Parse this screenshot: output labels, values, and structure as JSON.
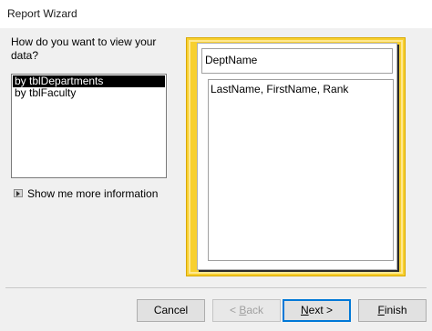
{
  "window": {
    "title": "Report Wizard"
  },
  "question": "How do you want to view your data?",
  "view_options": [
    {
      "label": "by tblDepartments",
      "selected": true
    },
    {
      "label": "by tblFaculty",
      "selected": false
    }
  ],
  "help_link": "Show me more information",
  "preview": {
    "group_field": "DeptName",
    "detail_fields": "LastName, FirstName, Rank"
  },
  "buttons": {
    "cancel": "Cancel",
    "back": {
      "prefix": "< ",
      "mnemonic": "B",
      "rest": "ack"
    },
    "next": {
      "mnemonic": "N",
      "rest": "ext >"
    },
    "finish": {
      "mnemonic": "F",
      "rest": "inish"
    }
  },
  "colors": {
    "preview_border": "#f8d030",
    "default_button_border": "#0078d7",
    "selection": "#000000"
  }
}
